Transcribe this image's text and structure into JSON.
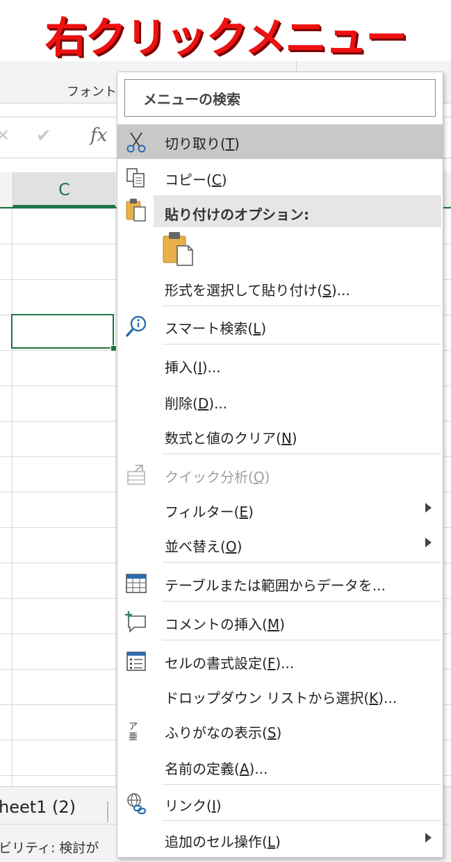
{
  "title": "右クリックメニュー",
  "ribbon": {
    "group_label": "フォント"
  },
  "formula_bar": {
    "cancel_glyph": "✕",
    "enter_glyph": "✔",
    "fx_label": "fx"
  },
  "grid": {
    "column_header": "C"
  },
  "sheet_tabs": {
    "active": "heet1 (2)"
  },
  "status_bar": {
    "text": "ビリティ: 検討が"
  },
  "menu": {
    "search_placeholder": "メニューの検索",
    "cut": {
      "label": "切り取り(",
      "key": "T",
      "tail": ")"
    },
    "copy": {
      "label": "コピー(",
      "key": "C",
      "tail": ")"
    },
    "paste_options": "貼り付けのオプション:",
    "paste_special": {
      "label": "形式を選択して貼り付け(",
      "key": "S",
      "tail": ")..."
    },
    "smart_lookup": {
      "label": "スマート検索(",
      "key": "L",
      "tail": ")"
    },
    "insert": {
      "label": "挿入(",
      "key": "I",
      "tail": ")..."
    },
    "delete": {
      "label": "削除(",
      "key": "D",
      "tail": ")..."
    },
    "clear_contents": {
      "label": "数式と値のクリア(",
      "key": "N",
      "tail": ")"
    },
    "quick_analysis": {
      "label": "クイック分析(",
      "key": "Q",
      "tail": ")"
    },
    "filter": {
      "label": "フィルター(",
      "key": "E",
      "tail": ")"
    },
    "sort": {
      "label": "並べ替え(",
      "key": "O",
      "tail": ")"
    },
    "get_data": {
      "label": "テーブルまたは範囲からデータを..."
    },
    "insert_comment": {
      "label": "コメントの挿入(",
      "key": "M",
      "tail": ")"
    },
    "format_cells": {
      "label": "セルの書式設定(",
      "key": "F",
      "tail": ")..."
    },
    "dropdown_pick": {
      "label": "ドロップダウン リストから選択(",
      "key": "K",
      "tail": ")..."
    },
    "phonetic": {
      "label": "ふりがなの表示(",
      "key": "S",
      "tail": ")"
    },
    "define_name": {
      "label": "名前の定義(",
      "key": "A",
      "tail": ")..."
    },
    "link": {
      "label": "リンク(",
      "key": "I",
      "tail": ")"
    },
    "more_cell_actions": {
      "label": "追加のセル操作(",
      "key": "L",
      "tail": ")"
    },
    "phonetic_icon_glyph": "ア亜"
  },
  "colors": {
    "excel_green": "#217346",
    "title_red": "#ee1111",
    "hover_gray": "#c8c8c8",
    "icon_blue": "#2b6cb0",
    "icon_orange": "#e8b04a"
  }
}
